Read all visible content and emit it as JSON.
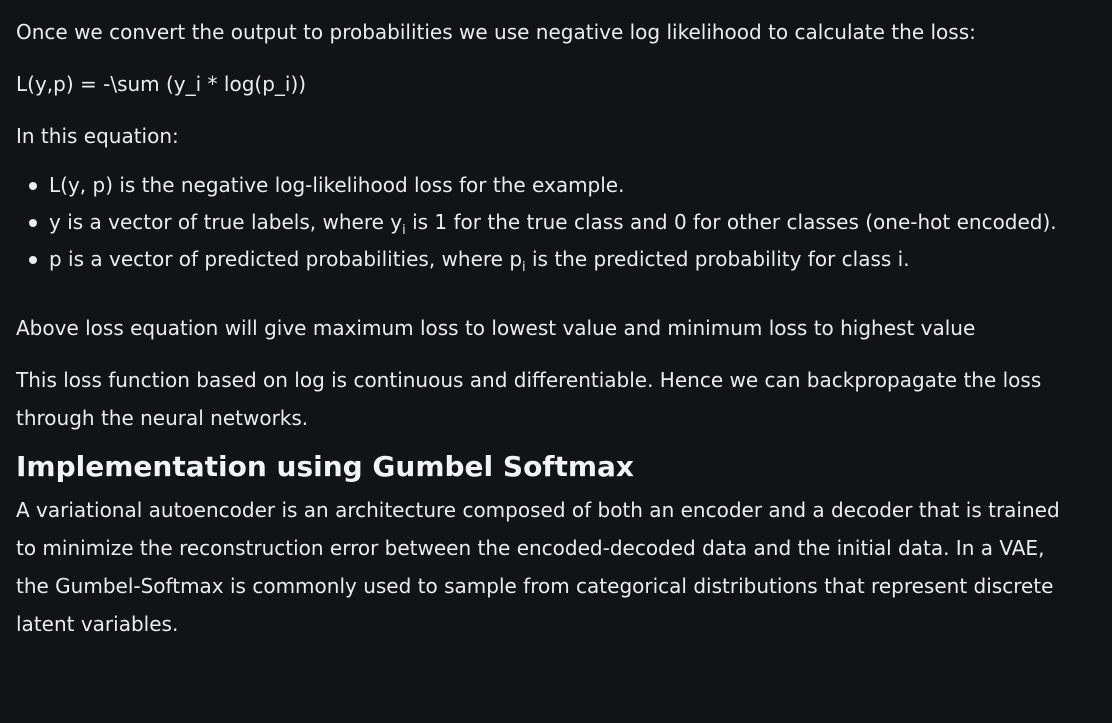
{
  "article": {
    "intro": "Once we convert the output to probabilities we use negative log likelihood to calculate the loss:",
    "formula": "L(y,p) = -\\sum (y_i * log(p_i))",
    "lead": "In this equation:",
    "bullets": {
      "b1": {
        "text": "L(y, p) is the negative log-likelihood loss for the example."
      },
      "b2": {
        "pre": "y is a vector of true labels, where y",
        "sub": "i",
        "post": " is 1 for the true class and 0 for other classes (one-hot encoded)."
      },
      "b3": {
        "pre": "p is a vector of predicted probabilities, where p",
        "sub": "i",
        "post": " is the predicted probability for class i."
      }
    },
    "above_loss": "Above loss equation will give maximum loss to lowest value and minimum loss to highest value",
    "loss_function": "This loss function based on log is continuous and differentiable. Hence we can backpropagate the loss through the neural networks.",
    "heading": "Implementation using Gumbel Softmax",
    "vae_paragraph": "A variational autoencoder is an architecture composed of both an encoder and a decoder that is trained to minimize the reconstruction error between the encoded-decoded data and the initial data. In a VAE, the Gumbel-Softmax is commonly used to sample from categorical distributions that represent discrete latent variables."
  }
}
